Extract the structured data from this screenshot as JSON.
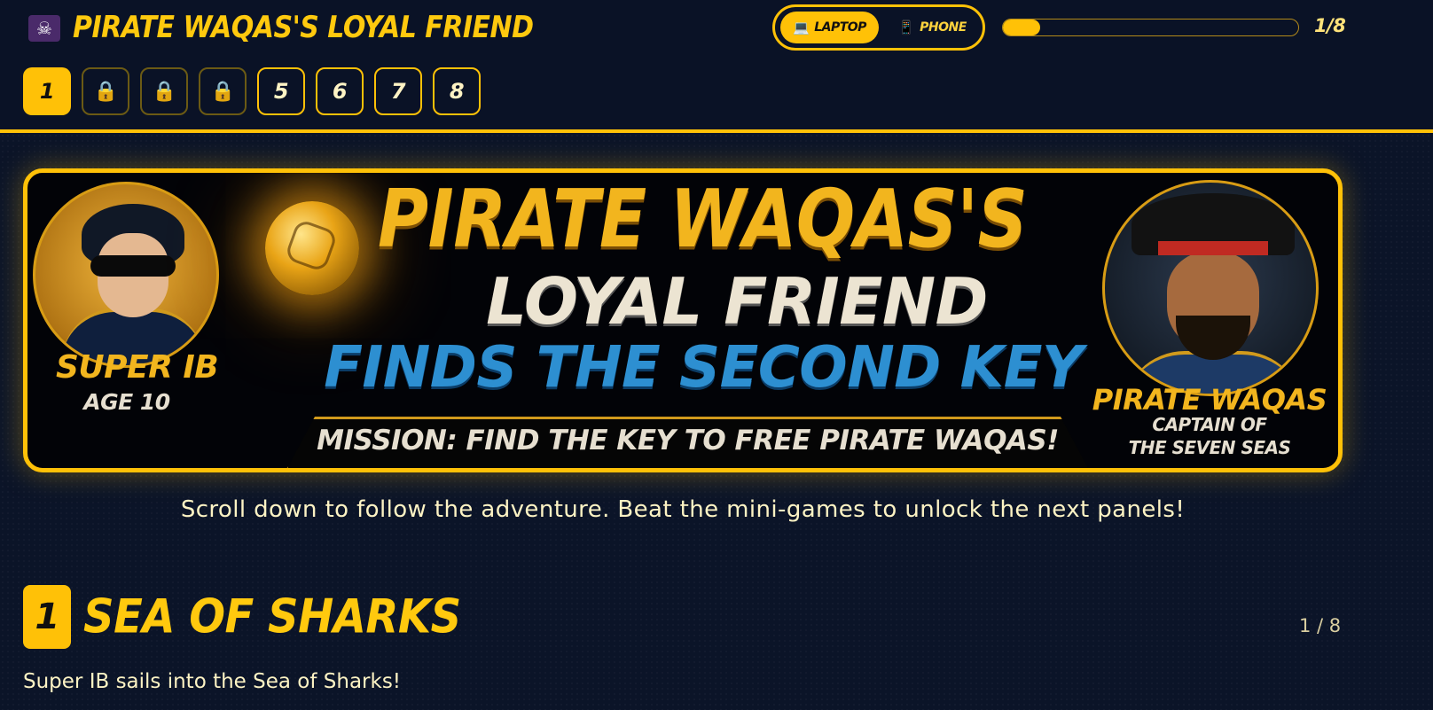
{
  "app": {
    "title": "PIRATE WAQAS'S LOYAL FRIEND",
    "icon": "skull-crossbones-icon",
    "icon_glyph": "☠"
  },
  "device_toggle": {
    "laptop": {
      "label": "LAPTOP",
      "icon": "laptop-icon",
      "glyph": "💻"
    },
    "phone": {
      "label": "PHONE",
      "icon": "phone-icon",
      "glyph": "📱"
    },
    "selected": "laptop"
  },
  "progress": {
    "value": 0.125,
    "label": "1/8"
  },
  "panels": [
    {
      "label": "1",
      "state": "active"
    },
    {
      "label": "🔒",
      "state": "locked",
      "icon": "lock-icon"
    },
    {
      "label": "🔒",
      "state": "locked",
      "icon": "lock-icon"
    },
    {
      "label": "🔒",
      "state": "locked",
      "icon": "lock-icon"
    },
    {
      "label": "5",
      "state": "open"
    },
    {
      "label": "6",
      "state": "open"
    },
    {
      "label": "7",
      "state": "open"
    },
    {
      "label": "8",
      "state": "open"
    }
  ],
  "banner": {
    "line1": "PIRATE WAQAS'S",
    "line2": "LOYAL FRIEND",
    "line3": "FINDS THE SECOND KEY",
    "mission": "MISSION: FIND THE KEY TO FREE PIRATE WAQAS!",
    "hero": {
      "name": "SUPER IB",
      "age": "AGE 10"
    },
    "pirate": {
      "name": "PIRATE WAQAS",
      "title_line1": "CAPTAIN OF",
      "title_line2": "THE SEVEN SEAS"
    }
  },
  "intro": "Scroll down to follow the adventure. Beat the mini-games to unlock the next panels!",
  "section": {
    "number": "1",
    "title": "SEA OF SHARKS",
    "counter": "1 / 8",
    "caption": "Super IB sails into the Sea of Sharks!"
  },
  "colors": {
    "accent": "#ffc107",
    "background": "#0b1428",
    "banner_blue": "#2d8fd1",
    "text": "#fdf3c4"
  }
}
